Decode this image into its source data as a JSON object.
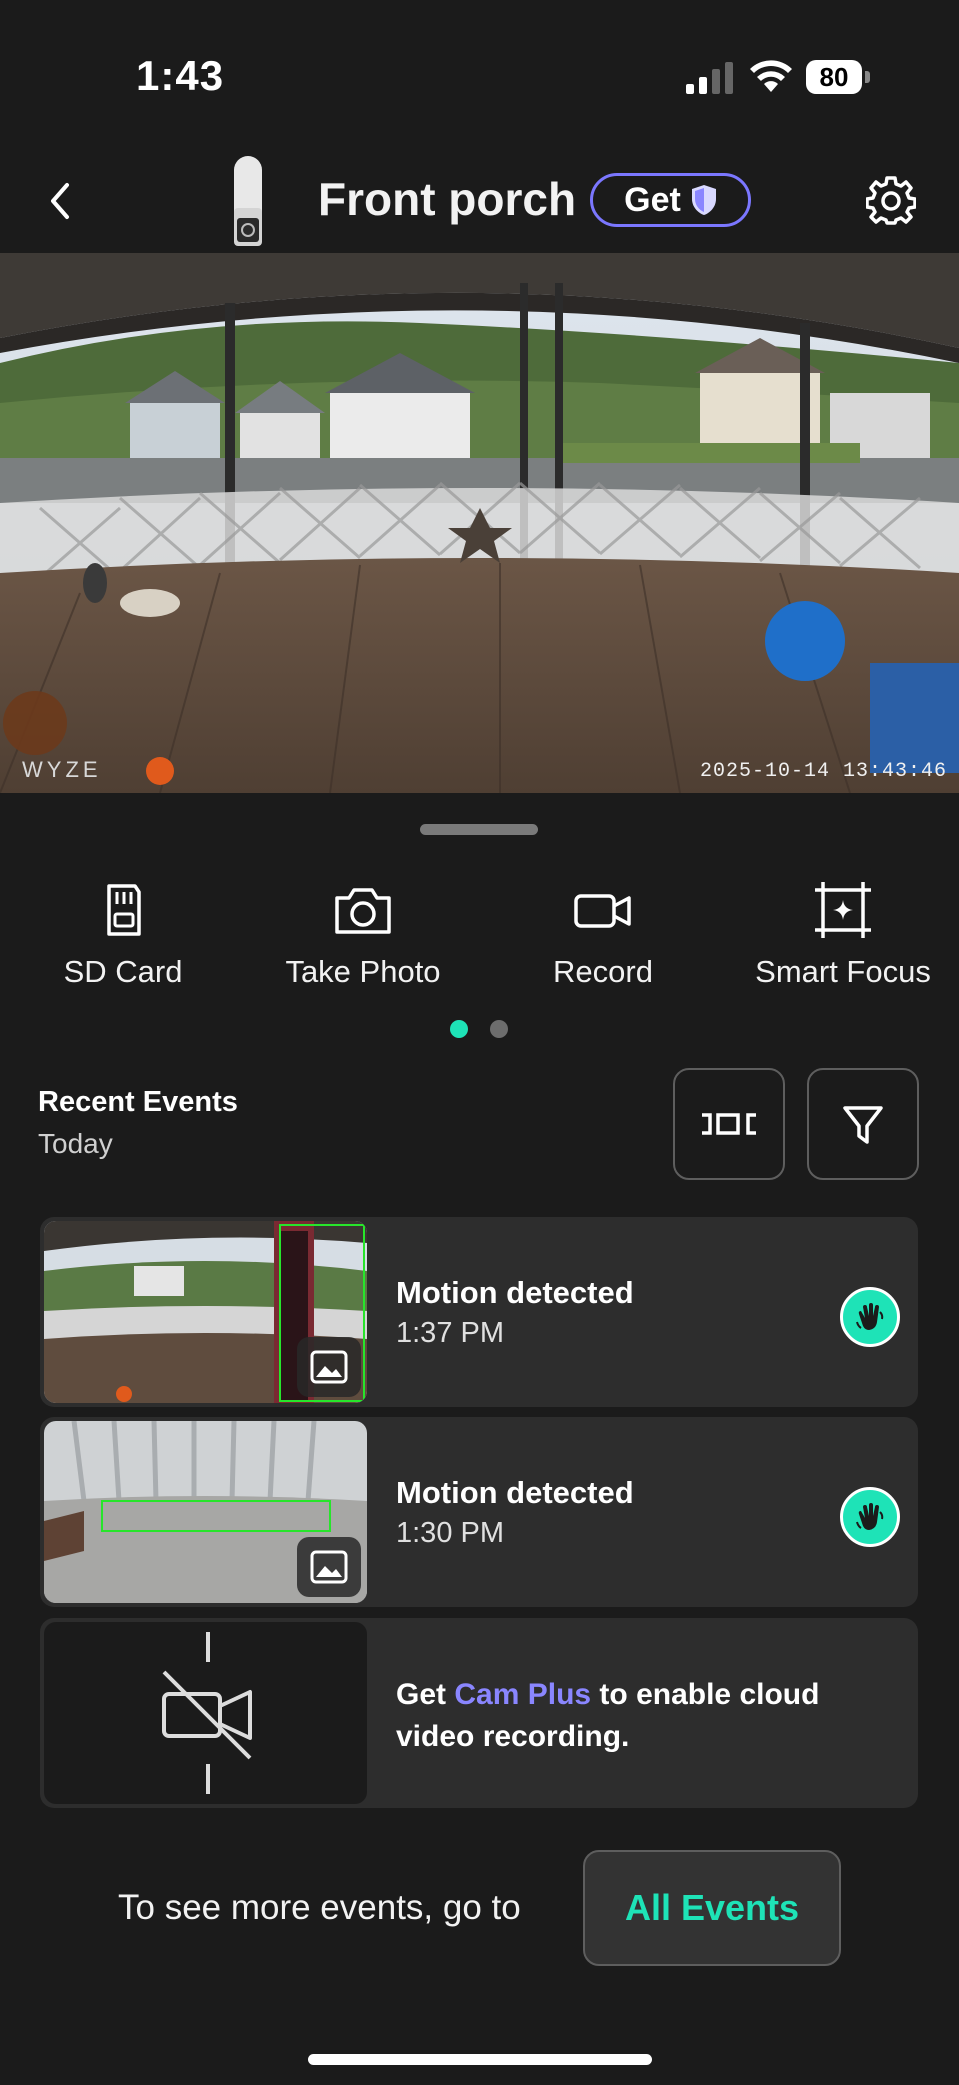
{
  "status_bar": {
    "time": "1:43",
    "battery": "80"
  },
  "header": {
    "title": "Front porch",
    "get_label": "Get"
  },
  "feed": {
    "brand": "WYZE",
    "timestamp": "2025-10-14  13:43:46"
  },
  "actions": [
    {
      "label": "SD Card",
      "icon": "sd-card-icon"
    },
    {
      "label": "Take Photo",
      "icon": "camera-icon"
    },
    {
      "label": "Record",
      "icon": "video-icon"
    },
    {
      "label": "Smart Focus",
      "icon": "smart-focus-icon"
    }
  ],
  "pager": {
    "pages": 2,
    "active": 1
  },
  "events": {
    "title": "Recent Events",
    "subtitle": "Today",
    "items": [
      {
        "title": "Motion detected",
        "time": "1:37 PM",
        "icon": "motion-hand-icon"
      },
      {
        "title": "Motion detected",
        "time": "1:30 PM",
        "icon": "motion-hand-icon"
      }
    ],
    "promo": {
      "prefix": "Get ",
      "highlight": "Cam Plus",
      "suffix": " to enable cloud video recording."
    }
  },
  "footer": {
    "text": "To see more events, go to",
    "button": "All Events"
  },
  "colors": {
    "accent": "#1ee3b7",
    "brand_purple": "#7b77ff",
    "background": "#1b1b1b",
    "card": "#2d2d2d"
  }
}
